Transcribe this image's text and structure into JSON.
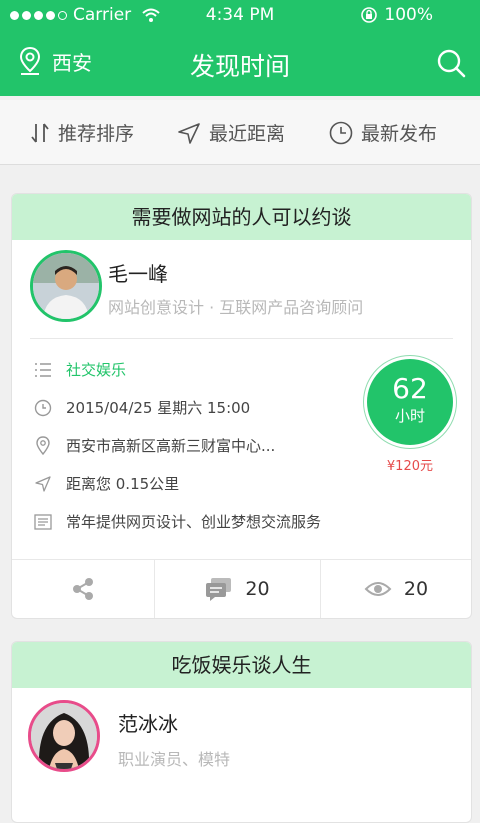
{
  "status_bar": {
    "carrier": "Carrier",
    "time": "4:34 PM",
    "battery": "100%"
  },
  "nav": {
    "location": "西安",
    "title": "发现时间"
  },
  "sort": [
    {
      "label": "推荐排序",
      "icon": "sort-icon"
    },
    {
      "label": "最近距离",
      "icon": "location-arrow-icon"
    },
    {
      "label": "最新发布",
      "icon": "clock-icon"
    }
  ],
  "cards": [
    {
      "title": "需要做网站的人可以约谈",
      "user": {
        "name": "毛一峰",
        "role": "网站创意设计 · 互联网产品咨询顾问"
      },
      "category": "社交娱乐",
      "datetime": "2015/04/25  星期六  15:00",
      "address": "西安市高新区高新三财富中心...",
      "distance": "距离您  0.15公里",
      "description": "常年提供网页设计、创业梦想交流服务",
      "hours": "62",
      "hours_unit": "小时",
      "price": "¥120元",
      "comments": "20",
      "views": "20"
    },
    {
      "title": "吃饭娱乐谈人生",
      "user": {
        "name": "范冰冰",
        "role": "职业演员、模特"
      }
    }
  ],
  "colors": {
    "brand": "#22c46a",
    "card_header": "#c7f2d2",
    "price": "#e64b4b",
    "avatar_ring_alt": "#e84c8a"
  }
}
